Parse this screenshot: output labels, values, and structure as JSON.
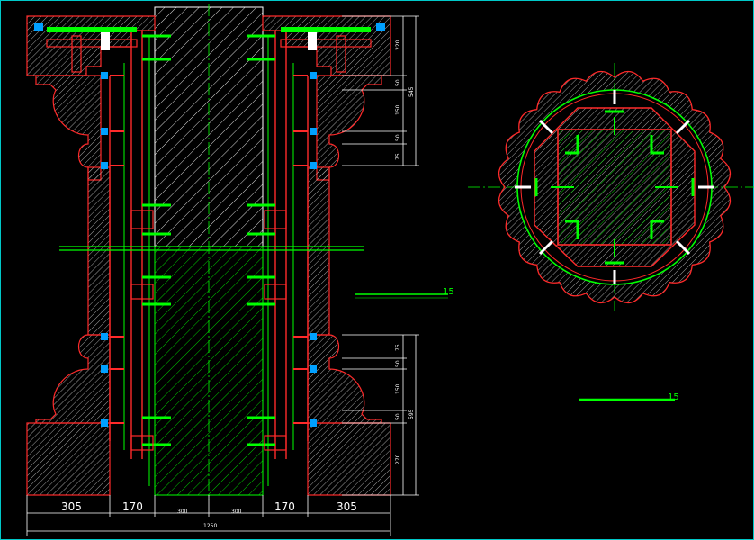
{
  "drawing": {
    "elevation": {
      "bottom_dims": [
        {
          "id": "left-outer",
          "label": "305"
        },
        {
          "id": "left-inner",
          "label": "170"
        },
        {
          "id": "core-left",
          "label": "300"
        },
        {
          "id": "core-right",
          "label": "300"
        },
        {
          "id": "right-inner",
          "label": "170"
        },
        {
          "id": "right-outer",
          "label": "305"
        }
      ],
      "total_dim": "1250",
      "right_dims_top": [
        "220",
        "50",
        "150",
        "50",
        "75"
      ],
      "right_total_top": "545",
      "right_dims_bottom": [
        "75",
        "50",
        "150",
        "50",
        "270"
      ],
      "right_total_bottom": "595"
    },
    "scale_labels": {
      "elevation": "15",
      "plan": "15"
    },
    "colors": {
      "background": "#000000",
      "frame": "#00c8c8",
      "outline": "#ff2a2a",
      "formwork": "#00ff00",
      "hatch": "#ffffff",
      "dimension": "#ffffff",
      "bolt": "#00a0ff"
    }
  }
}
